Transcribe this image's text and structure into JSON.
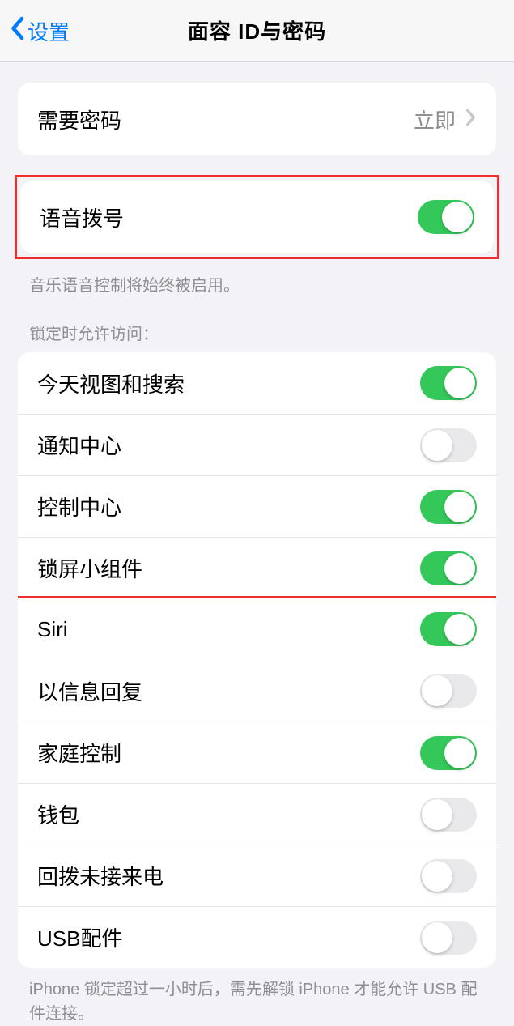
{
  "nav": {
    "back_label": "设置",
    "title": "面容 ID与密码"
  },
  "require_passcode": {
    "label": "需要密码",
    "value": "立即"
  },
  "voice_dial": {
    "label": "语音拨号",
    "on": true
  },
  "voice_dial_footer": "音乐语音控制将始终被启用。",
  "lock_header": "锁定时允许访问：",
  "lock_items": [
    {
      "label": "今天视图和搜索",
      "on": true
    },
    {
      "label": "通知中心",
      "on": false
    },
    {
      "label": "控制中心",
      "on": true
    },
    {
      "label": "锁屏小组件",
      "on": true
    },
    {
      "label": "Siri",
      "on": true
    },
    {
      "label": "以信息回复",
      "on": false
    },
    {
      "label": "家庭控制",
      "on": true
    },
    {
      "label": "钱包",
      "on": false
    },
    {
      "label": "回拨未接来电",
      "on": false
    },
    {
      "label": "USB配件",
      "on": false
    }
  ],
  "usb_footer": "iPhone 锁定超过一小时后，需先解锁 iPhone 才能允许 USB 配件连接。",
  "highlights": {
    "voice_dial": true,
    "siri_index": 4
  }
}
